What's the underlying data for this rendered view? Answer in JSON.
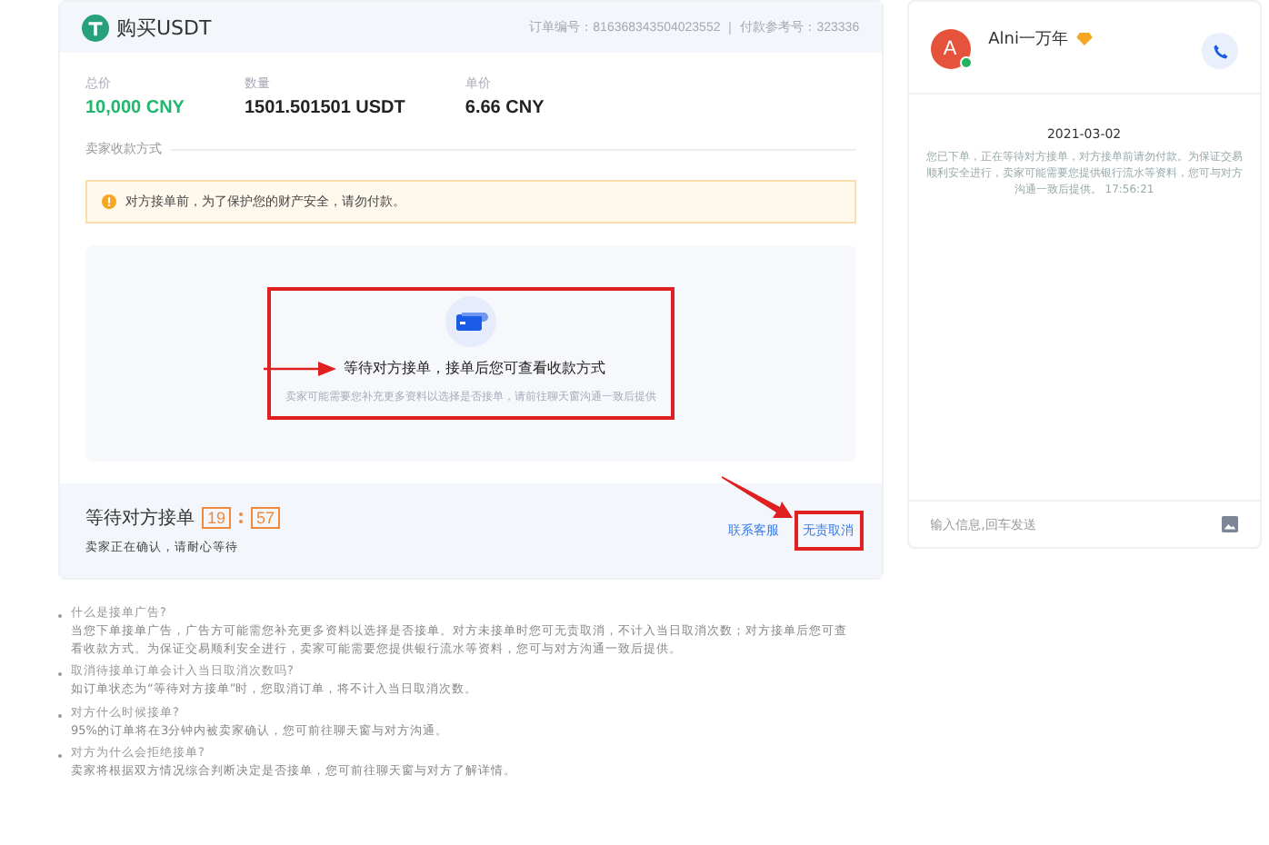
{
  "order": {
    "title": "购买USDT",
    "order_no_label": "订单编号：",
    "order_no": "816368343504023552",
    "ref_label": "付款参考号：",
    "ref_no": "323336"
  },
  "stats": [
    {
      "label": "总价",
      "value": "10,000 CNY",
      "kind": "accent"
    },
    {
      "label": "数量",
      "value": "1501.501501 USDT",
      "kind": "plain"
    },
    {
      "label": "单价",
      "value": "6.66 CNY",
      "kind": "plain"
    }
  ],
  "payment_section": {
    "title": "卖家收款方式",
    "warning": "对方接单前，为了保护您的财产安全，请勿付款。"
  },
  "pending": {
    "title": "等待对方接单，接单后您可查看收款方式",
    "note": "卖家可能需要您补充更多资料以选择是否接单，请前往聊天窗沟通一致后提供",
    "highlighted": true
  },
  "footer": {
    "status": "等待对方接单",
    "minutes": "19",
    "seconds": "57",
    "sub": "卖家正在确认，请耐心等待",
    "links": [
      {
        "label": "联系客服",
        "highlighted": false
      },
      {
        "label": "无责取消",
        "highlighted": true
      }
    ]
  },
  "chat": {
    "name": "Alni一万年",
    "avatar": "A",
    "online": true,
    "date": "2021-03-02",
    "message": "您已下单，正在等待对方接单，对方接单前请勿付款。为保证交易顺利安全进行，卖家可能需要您提供银行流水等资料，您可与对方沟通一致后提供。",
    "time": "17:56:21",
    "placeholder": "输入信息,回车发送"
  },
  "faq": [
    {
      "q": "什么是接单广告?",
      "a": "当您下单接单广告，广告方可能需您补充更多资料以选择是否接单。对方未接单时您可无责取消，不计入当日取消次数；对方接单后您可查看收款方式。为保证交易顺利安全进行，卖家可能需要您提供银行流水等资料，您可与对方沟通一致后提供。"
    },
    {
      "q": "取消待接单订单会计入当日取消次数吗?",
      "a": "如订单状态为“等待对方接单”时，您取消订单，将不计入当日取消次数。"
    },
    {
      "q": "对方什么时候接单?",
      "a": "95%的订单将在3分钟内被卖家确认，您可前往聊天窗与对方沟通。"
    },
    {
      "q": "对方为什么会拒绝接单?",
      "a": "卖家将根据双方情况综合判断决定是否接单，您可前往聊天窗与对方了解详情。"
    }
  ]
}
